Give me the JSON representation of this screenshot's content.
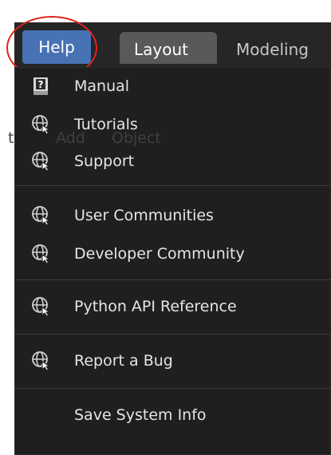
{
  "topbar": {
    "help_label": "Help",
    "tabs": [
      {
        "label": "Layout"
      },
      {
        "label": "Modeling"
      }
    ],
    "background_labels": [
      "t",
      "Add",
      "Object"
    ]
  },
  "menu": {
    "items": [
      {
        "label": "Manual",
        "icon": "manual-book-icon"
      },
      {
        "label": "Tutorials",
        "icon": "globe-link-icon"
      },
      {
        "label": "Support",
        "icon": "globe-link-icon"
      },
      {
        "label": "User Communities",
        "icon": "globe-link-icon"
      },
      {
        "label": "Developer Community",
        "icon": "globe-link-icon"
      },
      {
        "label": "Python API Reference",
        "icon": "globe-link-icon"
      },
      {
        "label": "Report a Bug",
        "icon": "globe-link-icon"
      },
      {
        "label": "Save System Info",
        "icon": ""
      }
    ]
  },
  "colors": {
    "accent": "#4772b3",
    "highlight_ring": "#e0221c",
    "menu_bg": "#1f1f1f",
    "topbar_bg": "#262626",
    "menu_text": "#e6e6e6"
  }
}
